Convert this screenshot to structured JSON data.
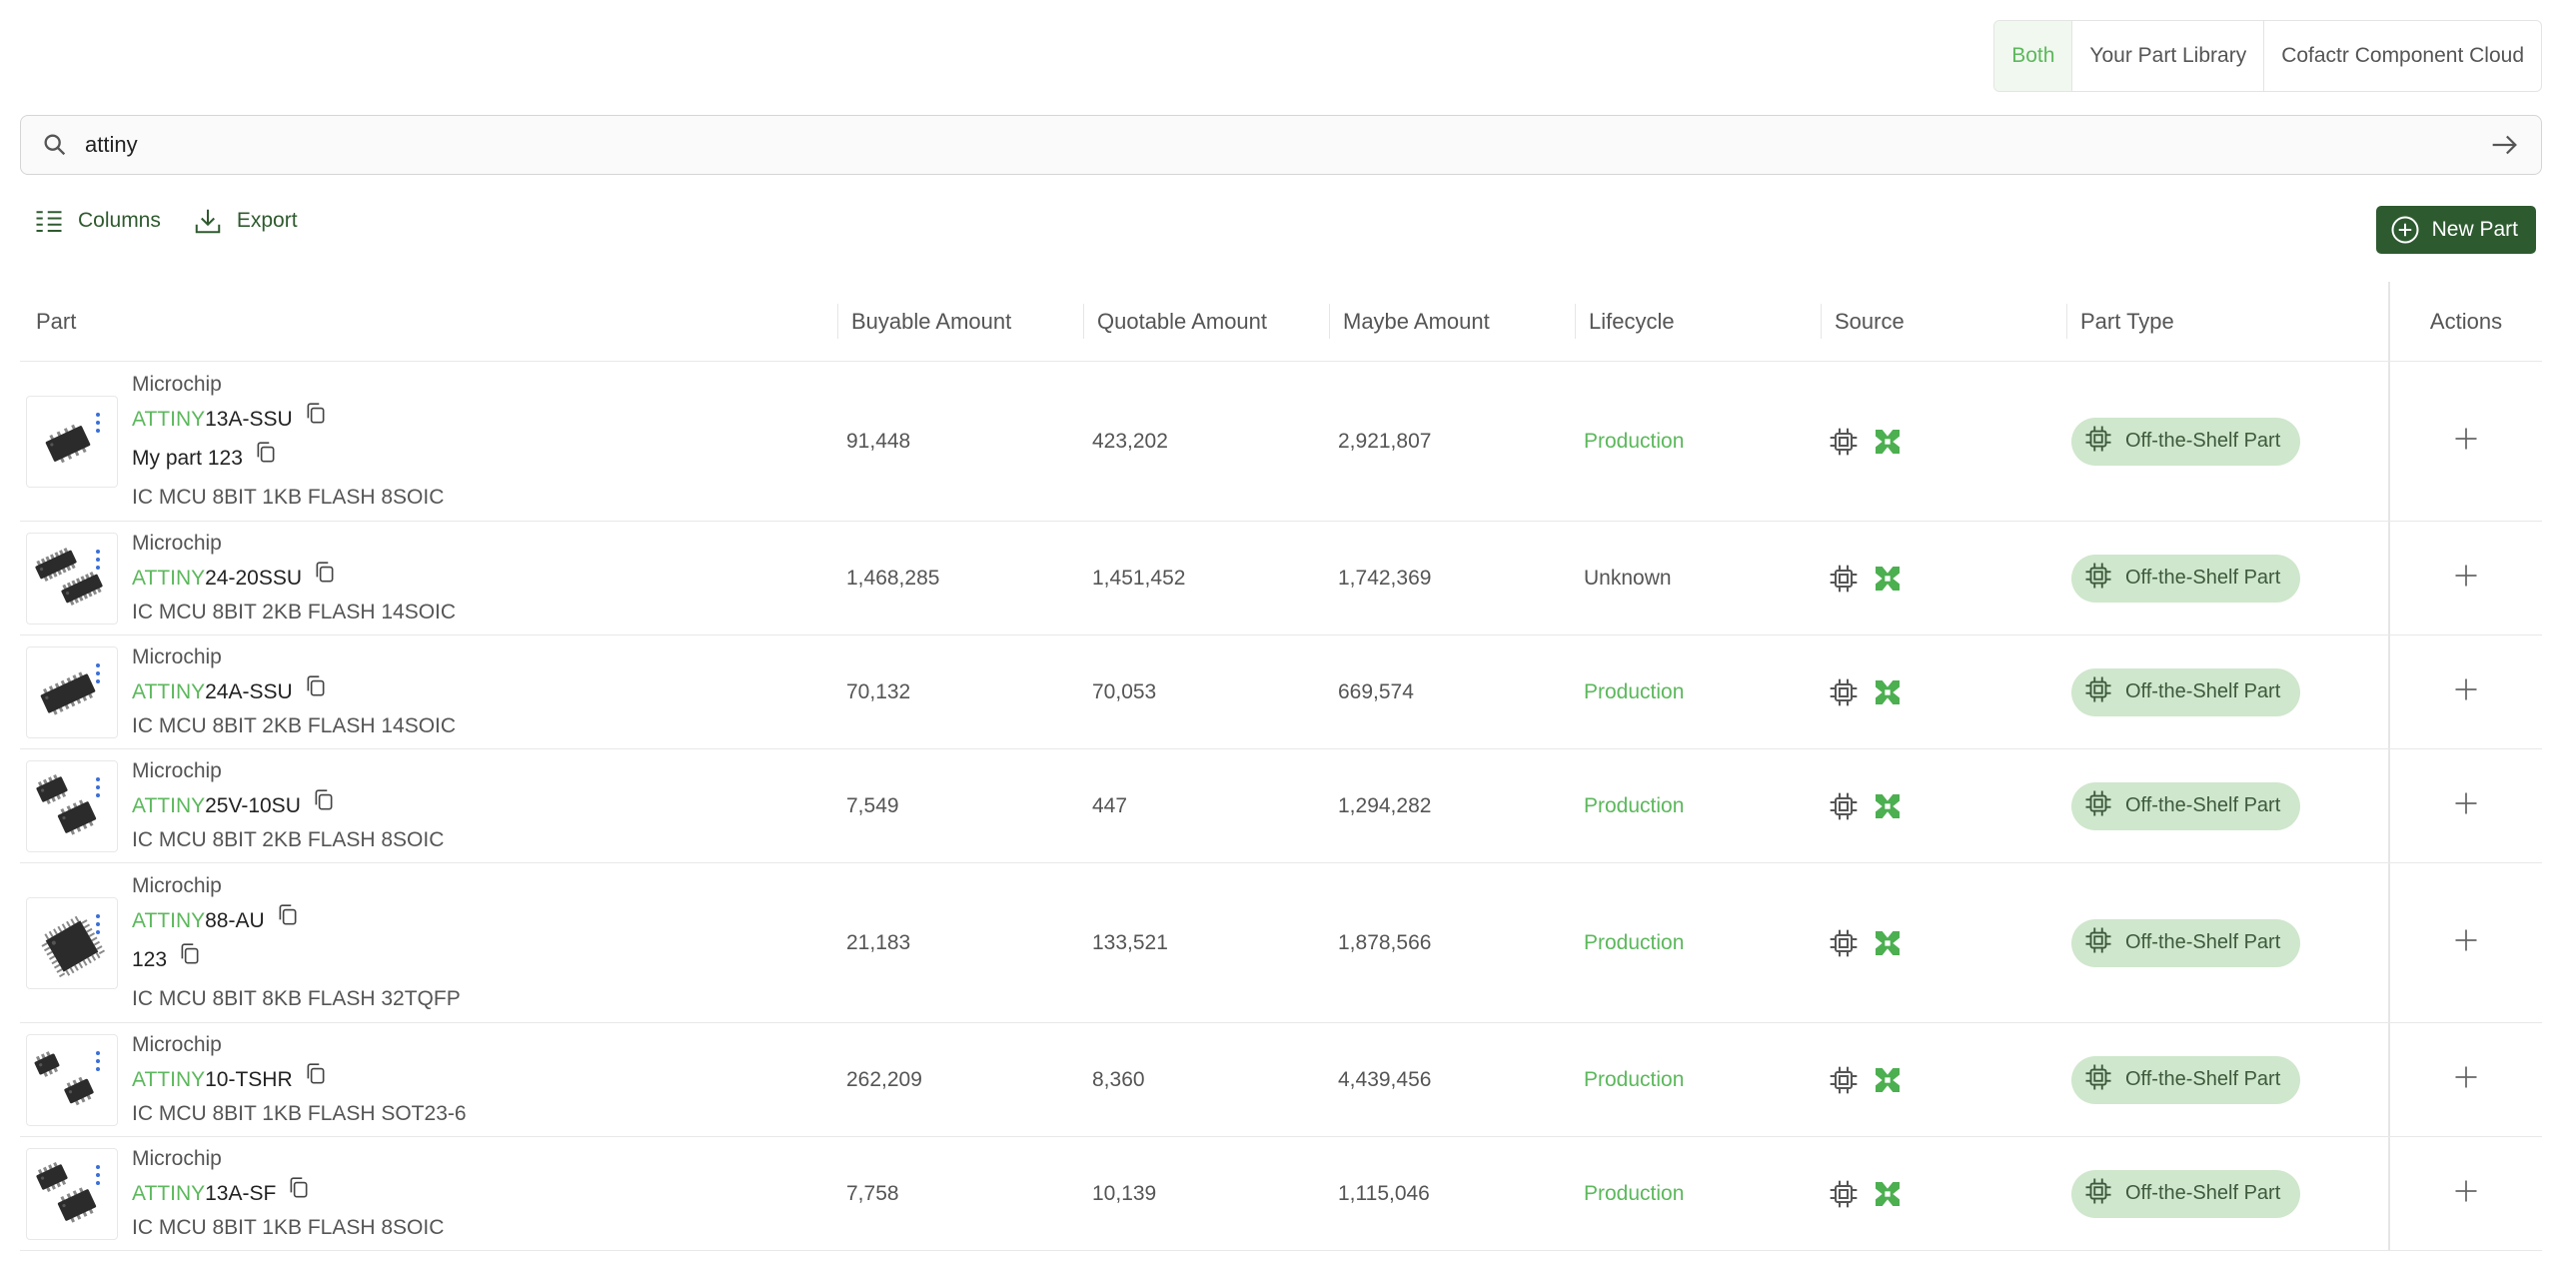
{
  "source_toggle": {
    "options": [
      "Both",
      "Your Part Library",
      "Cofactr Component Cloud"
    ],
    "selected": "Both"
  },
  "search": {
    "value": "attiny"
  },
  "toolbar": {
    "columns_label": "Columns",
    "export_label": "Export",
    "new_part_label": "New Part"
  },
  "colors": {
    "accent": "#5cb85c",
    "primary_button": "#2e5a30",
    "badge_bg": "#cfe7cc"
  },
  "table": {
    "headers": {
      "part": "Part",
      "buyable": "Buyable Amount",
      "quotable": "Quotable Amount",
      "maybe": "Maybe Amount",
      "lifecycle": "Lifecycle",
      "source": "Source",
      "part_type": "Part Type",
      "actions": "Actions"
    },
    "rows": [
      {
        "mfr": "Microchip",
        "mpn_hl": "ATTINY",
        "mpn_rest": "13A-SSU",
        "custom": "My part 123",
        "desc": "IC MCU 8BIT 1KB FLASH 8SOIC",
        "buyable": "91,448",
        "quotable": "423,202",
        "maybe": "2,921,807",
        "lifecycle": "Production",
        "part_type": "Off-the-Shelf Part",
        "pkg": "soic8"
      },
      {
        "mfr": "Microchip",
        "mpn_hl": "ATTINY",
        "mpn_rest": "24-20SSU",
        "custom": "",
        "desc": "IC MCU 8BIT 2KB FLASH 14SOIC",
        "buyable": "1,468,285",
        "quotable": "1,451,452",
        "maybe": "1,742,369",
        "lifecycle": "Unknown",
        "part_type": "Off-the-Shelf Part",
        "pkg": "soic14pair"
      },
      {
        "mfr": "Microchip",
        "mpn_hl": "ATTINY",
        "mpn_rest": "24A-SSU",
        "custom": "",
        "desc": "IC MCU 8BIT 2KB FLASH 14SOIC",
        "buyable": "70,132",
        "quotable": "70,053",
        "maybe": "669,574",
        "lifecycle": "Production",
        "part_type": "Off-the-Shelf Part",
        "pkg": "soic14"
      },
      {
        "mfr": "Microchip",
        "mpn_hl": "ATTINY",
        "mpn_rest": "25V-10SU",
        "custom": "",
        "desc": "IC MCU 8BIT 2KB FLASH 8SOIC",
        "buyable": "7,549",
        "quotable": "447",
        "maybe": "1,294,282",
        "lifecycle": "Production",
        "part_type": "Off-the-Shelf Part",
        "pkg": "soic8pair"
      },
      {
        "mfr": "Microchip",
        "mpn_hl": "ATTINY",
        "mpn_rest": "88-AU",
        "custom": "123",
        "desc": "IC MCU 8BIT 8KB FLASH 32TQFP",
        "buyable": "21,183",
        "quotable": "133,521",
        "maybe": "1,878,566",
        "lifecycle": "Production",
        "part_type": "Off-the-Shelf Part",
        "pkg": "tqfp"
      },
      {
        "mfr": "Microchip",
        "mpn_hl": "ATTINY",
        "mpn_rest": "10-TSHR",
        "custom": "",
        "desc": "IC MCU 8BIT 1KB FLASH SOT23-6",
        "buyable": "262,209",
        "quotable": "8,360",
        "maybe": "4,439,456",
        "lifecycle": "Production",
        "part_type": "Off-the-Shelf Part",
        "pkg": "sot23pair"
      },
      {
        "mfr": "Microchip",
        "mpn_hl": "ATTINY",
        "mpn_rest": "13A-SF",
        "custom": "",
        "desc": "IC MCU 8BIT 1KB FLASH 8SOIC",
        "buyable": "7,758",
        "quotable": "10,139",
        "maybe": "1,115,046",
        "lifecycle": "Production",
        "part_type": "Off-the-Shelf Part",
        "pkg": "soic8pair"
      }
    ]
  }
}
